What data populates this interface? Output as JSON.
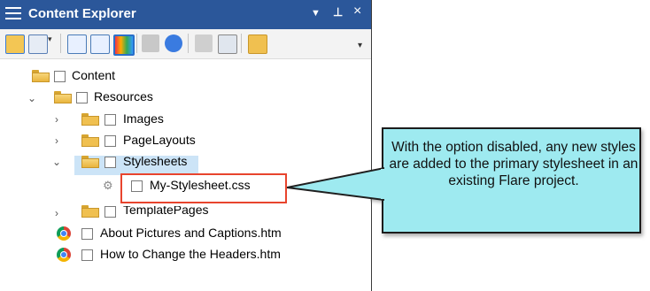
{
  "panel": {
    "title": "Content Explorer",
    "controls": {
      "dropdown": "▼",
      "pin": "⊥",
      "close": "×"
    }
  },
  "toolbar": {
    "buttons": [
      "folder-view-icon",
      "grid-view-icon",
      "copy-icon",
      "paste-icon",
      "color-grid-icon",
      "link-icon",
      "refresh-icon",
      "upload-icon",
      "properties-icon",
      "new-folder-icon"
    ]
  },
  "tree": {
    "root": "Content",
    "resources": "Resources",
    "images": "Images",
    "page_layouts": "PageLayouts",
    "stylesheets": "Stylesheets",
    "stylesheet_file": "My-Stylesheet.css",
    "template_pages": "TemplatePages",
    "file1": "About Pictures and Captions.htm",
    "file2": "How to Change the Headers.htm"
  },
  "callout": {
    "text": "With the option disabled, any new styles are added to the primary stylesheet in an existing Flare project."
  },
  "colors": {
    "titlebar": "#2b579a",
    "callout_fill": "#9eeaf0",
    "highlight": "#e8442d"
  }
}
